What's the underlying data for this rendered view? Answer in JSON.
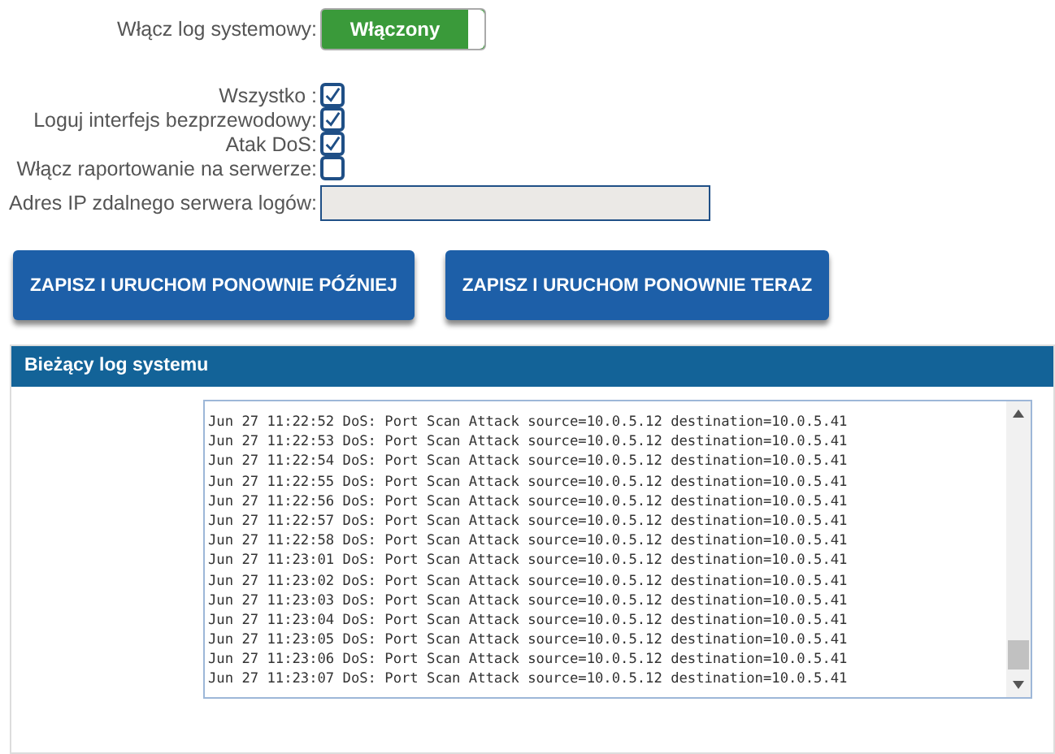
{
  "syslog_toggle": {
    "label": "Włącz log systemowy:",
    "value": "Włączony",
    "on": true
  },
  "options": [
    {
      "label": "Wszystko :",
      "checked": true
    },
    {
      "label": "Loguj interfejs bezprzewodowy:",
      "checked": true
    },
    {
      "label": "Atak DoS:",
      "checked": true
    },
    {
      "label": "Włącz raportowanie na serwerze:",
      "checked": false
    }
  ],
  "server_ip": {
    "label": "Adres IP zdalnego serwera logów:",
    "disabled": true
  },
  "buttons": [
    "ZAPISZ I URUCHOM PONOWNIE PÓŹNIEJ",
    "ZAPISZ I URUCHOM PONOWNIE TERAZ"
  ],
  "log_panel": {
    "title": "Bieżący log systemu",
    "lines": [
      "Jun 27 11:22:52  DoS: Port Scan Attack source=10.0.5.12 destination=10.0.5.41",
      "Jun 27 11:22:53  DoS: Port Scan Attack source=10.0.5.12 destination=10.0.5.41",
      "Jun 27 11:22:54  DoS: Port Scan Attack source=10.0.5.12 destination=10.0.5.41",
      "Jun 27 11:22:55  DoS: Port Scan Attack source=10.0.5.12 destination=10.0.5.41",
      "Jun 27 11:22:56  DoS: Port Scan Attack source=10.0.5.12 destination=10.0.5.41",
      "Jun 27 11:22:57  DoS: Port Scan Attack source=10.0.5.12 destination=10.0.5.41",
      "Jun 27 11:22:58  DoS: Port Scan Attack source=10.0.5.12 destination=10.0.5.41",
      "Jun 27 11:23:01  DoS: Port Scan Attack source=10.0.5.12 destination=10.0.5.41",
      "Jun 27 11:23:02  DoS: Port Scan Attack source=10.0.5.12 destination=10.0.5.41",
      "Jun 27 11:23:03  DoS: Port Scan Attack source=10.0.5.12 destination=10.0.5.41",
      "Jun 27 11:23:04  DoS: Port Scan Attack source=10.0.5.12 destination=10.0.5.41",
      "Jun 27 11:23:05  DoS: Port Scan Attack source=10.0.5.12 destination=10.0.5.41",
      "Jun 27 11:23:06  DoS: Port Scan Attack source=10.0.5.12 destination=10.0.5.41",
      "Jun 27 11:23:07  DoS: Port Scan Attack source=10.0.5.12 destination=10.0.5.41"
    ]
  }
}
